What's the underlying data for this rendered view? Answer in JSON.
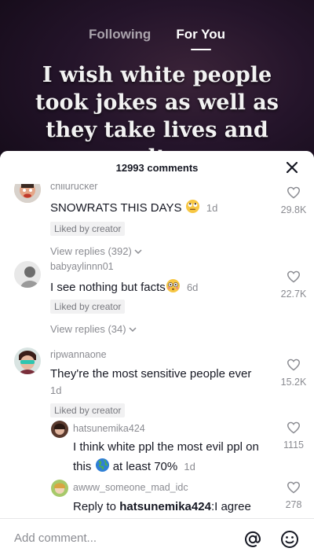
{
  "top_tabs": {
    "following": "Following",
    "for_you": "For You"
  },
  "video": {
    "caption_lines": [
      "I wish white people",
      "took jokes as well as",
      "they take lives and",
      "lt"
    ]
  },
  "comments_header": {
    "count_label": "12993 comments"
  },
  "comments": [
    {
      "username": "chilurucker",
      "text": "SNOWRATS THIS DAYS",
      "time": "1d",
      "badge": "Liked by creator",
      "replies_label": "View replies (392)",
      "likes": "29.8K"
    },
    {
      "username": "babyaylinnn01",
      "text": "I see nothing but facts",
      "time": "6d",
      "badge": "Liked by creator",
      "replies_label": "View replies (34)",
      "likes": "22.7K"
    },
    {
      "username": "ripwannaone",
      "text": "They're the most sensitive people ever",
      "time": "1d",
      "badge": "Liked by creator",
      "likes": "15.2K"
    }
  ],
  "replies": [
    {
      "username": "hatsunemika424",
      "text_line1": "I think white ppl the most evil ppl on",
      "text_line2_pre": "this",
      "text_line2_post": "at least 70%",
      "time": "1d",
      "likes": "1115"
    },
    {
      "username": "awww_someone_mad_idc",
      "text_prefix": "Reply to ",
      "mention": "hatsunemika424",
      "text_rest": ":I agree",
      "likes": "278"
    }
  ],
  "input": {
    "placeholder": "Add comment..."
  },
  "icons": {
    "close": "close-icon",
    "heart": "heart-outline-icon",
    "chevron": "chevron-down-icon",
    "at": "at-icon",
    "emoji": "emoji-icon"
  },
  "colors": {
    "text": "#161823",
    "muted": "#8a8b91",
    "sheet": "#ffffff",
    "badge_bg": "#f1f1f2"
  }
}
